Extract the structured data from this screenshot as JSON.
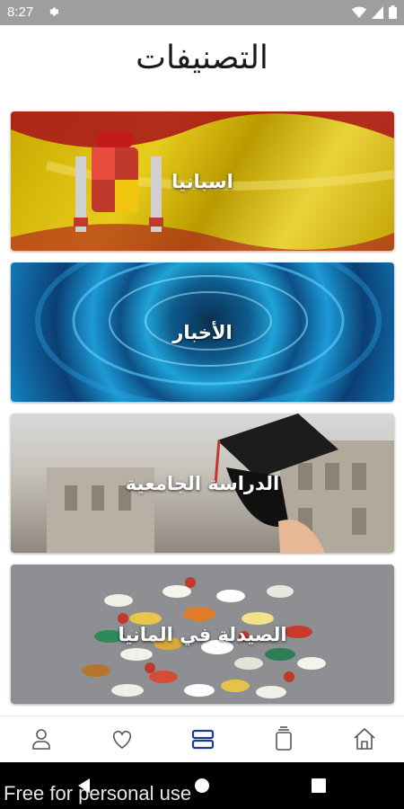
{
  "status_bar": {
    "time": "8:27"
  },
  "page": {
    "title": "التصنيفات"
  },
  "categories": [
    {
      "label": "اسبانيا"
    },
    {
      "label": "الأخبار"
    },
    {
      "label": "الدراسة الجامعية"
    },
    {
      "label": "الصيدلة في المانيا"
    }
  ],
  "bottom_nav": {
    "items": [
      "profile-icon",
      "favorites-icon",
      "categories-icon",
      "saved-icon",
      "home-icon"
    ],
    "active_color": "#1e3a8a",
    "inactive_color": "#555555"
  },
  "watermark": {
    "text": "Free for personal use"
  }
}
